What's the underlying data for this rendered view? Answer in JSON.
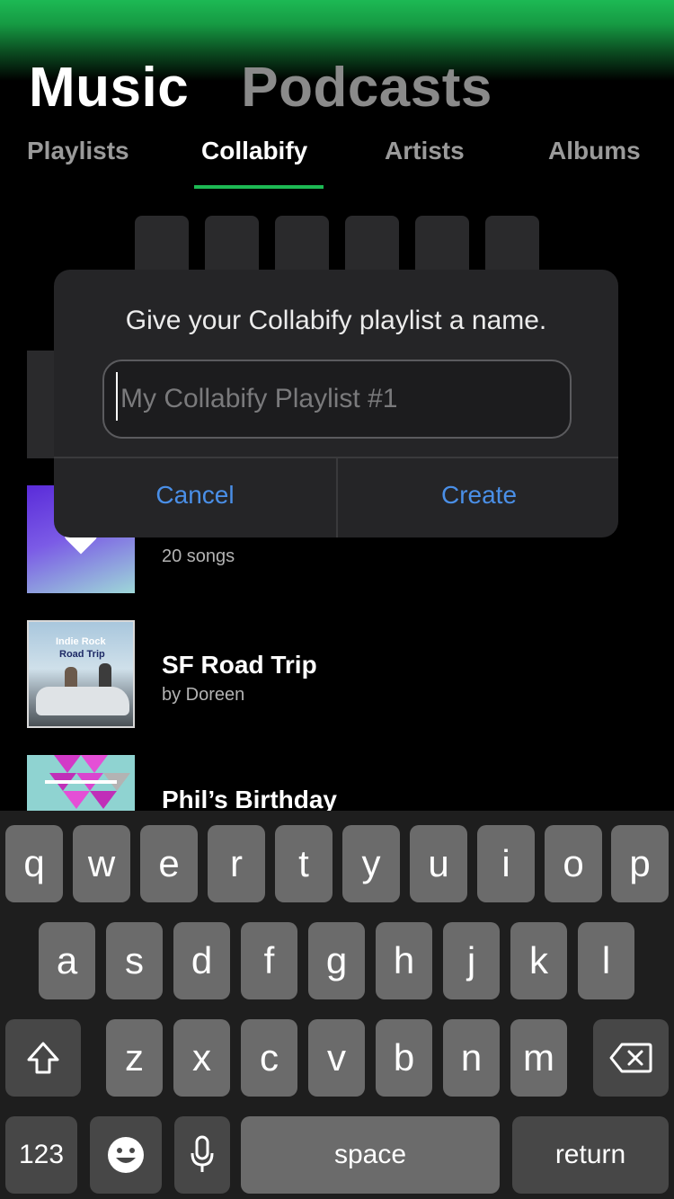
{
  "header": {
    "tabs": [
      {
        "label": "Music",
        "active": true
      },
      {
        "label": "Podcasts",
        "active": false
      }
    ]
  },
  "subtabs": [
    {
      "label": "Playlists",
      "active": false
    },
    {
      "label": "Collabify",
      "active": true
    },
    {
      "label": "Artists",
      "active": false
    },
    {
      "label": "Albums",
      "active": false
    }
  ],
  "playlists": [
    {
      "subtitle": "20 songs",
      "icon": "heart-icon"
    },
    {
      "title": "SF Road Trip",
      "subtitle": "by Doreen",
      "cover_text": [
        "Indie Rock",
        "Road Trip"
      ]
    },
    {
      "title": "Phil’s Birthday"
    }
  ],
  "dialog": {
    "message": "Give your Collabify playlist a name.",
    "placeholder": "My Collabify Playlist #1",
    "cancel_label": "Cancel",
    "create_label": "Create"
  },
  "keyboard": {
    "row1": [
      "q",
      "w",
      "e",
      "r",
      "t",
      "y",
      "u",
      "i",
      "o",
      "p"
    ],
    "row2": [
      "a",
      "s",
      "d",
      "f",
      "g",
      "h",
      "j",
      "k",
      "l"
    ],
    "row3": [
      "z",
      "x",
      "c",
      "v",
      "b",
      "n",
      "m"
    ],
    "numbers_label": "123",
    "space_label": "space",
    "return_label": "return"
  },
  "colors": {
    "accent": "#1db954",
    "link": "#4a8fe7"
  }
}
